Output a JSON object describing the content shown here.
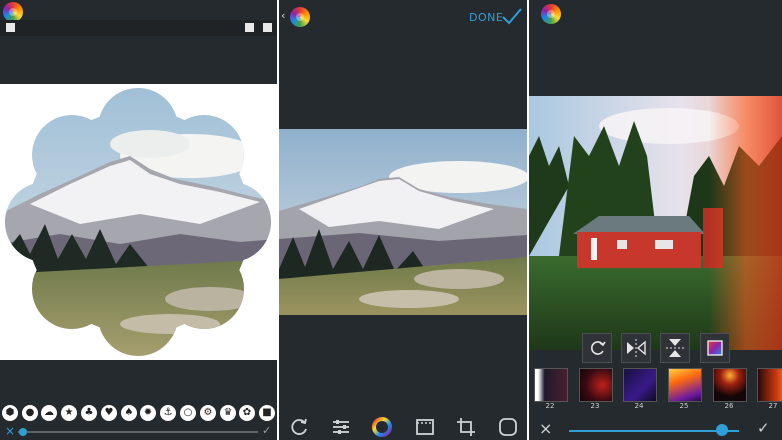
{
  "screen1": {
    "shapes": [
      {
        "icon": "hexagon-icon",
        "glyph": "⬢"
      },
      {
        "icon": "drop-icon",
        "glyph": "●"
      },
      {
        "icon": "cloud-icon",
        "glyph": "☁"
      },
      {
        "icon": "star-icon",
        "glyph": "★"
      },
      {
        "icon": "club-icon",
        "glyph": "♣"
      },
      {
        "icon": "heart-icon",
        "glyph": "♥"
      },
      {
        "icon": "spade-icon",
        "glyph": "♠"
      },
      {
        "icon": "badge-icon",
        "glyph": "✹"
      },
      {
        "icon": "anchor-icon",
        "glyph": "⚓"
      },
      {
        "icon": "circle-icon",
        "glyph": "○"
      },
      {
        "icon": "gear-icon",
        "glyph": "⚙"
      },
      {
        "icon": "crown-icon",
        "glyph": "♛"
      },
      {
        "icon": "flower-icon",
        "glyph": "✿"
      },
      {
        "icon": "square-icon",
        "glyph": "■"
      }
    ],
    "close_glyph": "×",
    "confirm_glyph": "✓",
    "slider_value": 0.02
  },
  "screen2": {
    "done_label": "DONE",
    "tools": [
      "rotate-icon",
      "adjust-icon",
      "color-wheel-icon",
      "film-icon",
      "crop-icon",
      "frame-icon"
    ]
  },
  "screen3": {
    "edit_tools": [
      "rotate-icon",
      "flip-horizontal-icon",
      "flip-vertical-icon",
      "color-overlay-icon"
    ],
    "filters": [
      {
        "label": "22"
      },
      {
        "label": "23"
      },
      {
        "label": "24"
      },
      {
        "label": "25"
      },
      {
        "label": "26"
      },
      {
        "label": "27"
      }
    ],
    "close_glyph": "×",
    "confirm_glyph": "✓",
    "slider_value": 0.9
  },
  "colors": {
    "accent": "#2f9fd6",
    "panel": "#252a2e"
  }
}
